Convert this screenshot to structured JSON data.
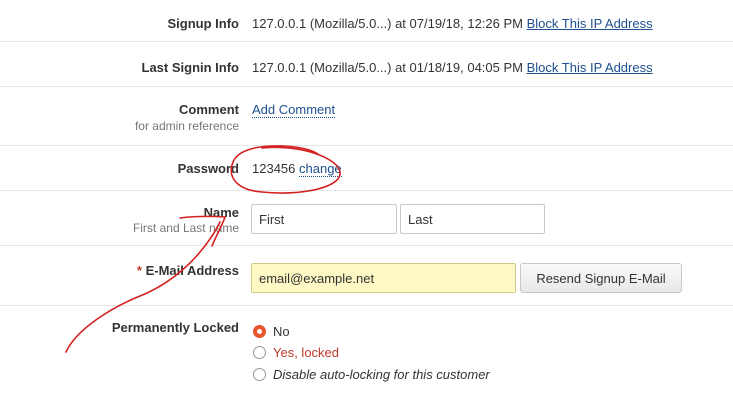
{
  "signup_info": {
    "label": "Signup Info",
    "value": "127.0.0.1 (Mozilla/5.0...) at 07/19/18, 12:26 PM",
    "link": "Block This IP Address"
  },
  "last_signin_info": {
    "label": "Last Signin Info",
    "value": "127.0.0.1 (Mozilla/5.0...) at 01/18/19, 04:05 PM",
    "link": "Block This IP Address"
  },
  "comment": {
    "label": "Comment",
    "sublabel": "for admin reference",
    "link": "Add Comment"
  },
  "password": {
    "label": "Password",
    "value": "123456",
    "link": "change"
  },
  "name": {
    "label": "Name",
    "sublabel": "First and Last name",
    "first_value": "First",
    "last_value": "Last"
  },
  "email": {
    "required_mark": "*",
    "label": "E-Mail Address",
    "value": "email@example.net",
    "resend_button": "Resend Signup E-Mail"
  },
  "permanently_locked": {
    "label": "Permanently Locked",
    "options": [
      {
        "label": "No",
        "checked": true
      },
      {
        "label": "Yes, locked",
        "checked": false
      },
      {
        "label": "Disable auto-locking for this customer",
        "checked": false
      }
    ]
  },
  "colors": {
    "link": "#1f4f8f",
    "radio_checked": "#e8552d",
    "annotation": "#d42020",
    "input_highlight": "#fdf8c4"
  }
}
